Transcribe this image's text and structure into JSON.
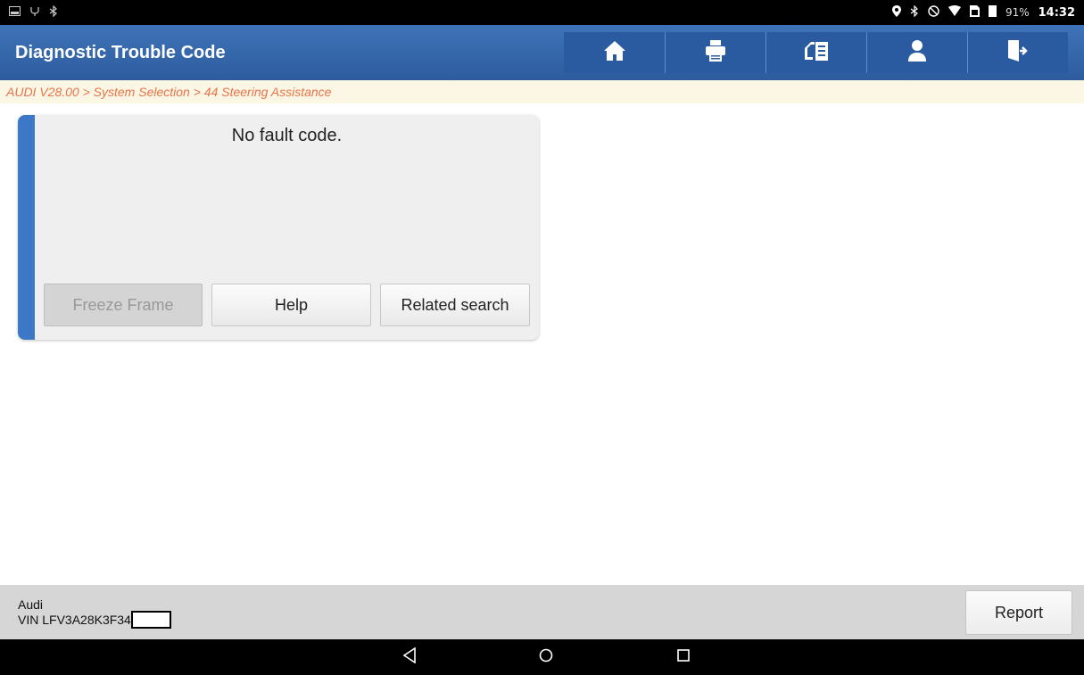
{
  "status_bar": {
    "battery_percent": "91%",
    "time": "14:32",
    "left_icons": [
      "screenshot-icon",
      "usb-icon",
      "bluetooth-icon"
    ],
    "right_icons": [
      "location-icon",
      "bluetooth-icon",
      "do-not-disturb-icon",
      "wifi-icon",
      "sim-icon",
      "signal-icon"
    ]
  },
  "header": {
    "title": "Diagnostic Trouble Code",
    "buttons": [
      "home-icon",
      "print-icon",
      "edit-list-icon",
      "user-icon",
      "exit-icon"
    ]
  },
  "breadcrumb": "AUDI V28.00 > System Selection > 44 Steering Assistance",
  "result": {
    "message": "No fault code.",
    "freeze_frame_label": "Freeze Frame",
    "help_label": "Help",
    "related_search_label": "Related search"
  },
  "vehicle": {
    "make": "Audi",
    "vin_text": "VIN LFV3A28K3F34"
  },
  "report_label": "Report",
  "colors": {
    "header_blue": "#3f73b8",
    "accent_blue": "#3d78c7",
    "breadcrumb_text": "#e8734a"
  }
}
